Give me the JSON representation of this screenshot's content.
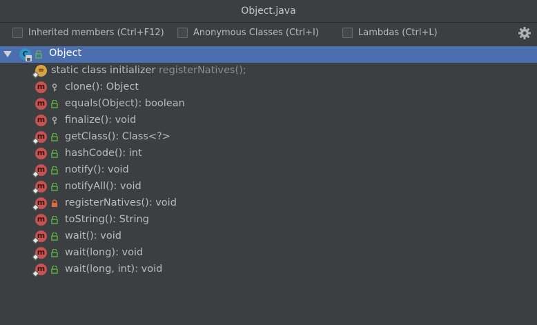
{
  "window": {
    "title": "Object.java"
  },
  "toolbar": {
    "inherited_label": "Inherited members (Ctrl+F12)",
    "anonymous_label": "Anonymous Classes (Ctrl+I)",
    "lambdas_label": "Lambdas (Ctrl+L)",
    "settings_icon": "gear-icon"
  },
  "tree": {
    "root": {
      "label": "Object",
      "icon": "class-icon",
      "icon_letter": "C"
    },
    "init": {
      "label": "static class initializer",
      "detail": "registerNatives();",
      "icon_letter": "="
    },
    "method_icon_letter": "m",
    "methods": [
      {
        "label": "clone(): Object",
        "visibility": "protected"
      },
      {
        "label": "equals(Object): boolean",
        "visibility": "public"
      },
      {
        "label": "finalize(): void",
        "visibility": "protected"
      },
      {
        "label": "getClass(): Class<?>",
        "visibility": "public"
      },
      {
        "label": "hashCode(): int",
        "visibility": "public"
      },
      {
        "label": "notify(): void",
        "visibility": "public"
      },
      {
        "label": "notifyAll(): void",
        "visibility": "public"
      },
      {
        "label": "registerNatives(): void",
        "visibility": "private"
      },
      {
        "label": "toString(): String",
        "visibility": "public"
      },
      {
        "label": "wait(): void",
        "visibility": "public"
      },
      {
        "label": "wait(long): void",
        "visibility": "public"
      },
      {
        "label": "wait(long, int): void",
        "visibility": "public"
      }
    ]
  },
  "colors": {
    "background": "#3c3f41",
    "selection": "#4b6eaf",
    "method_icon": "#c75450",
    "class_icon": "#3592c4",
    "init_icon": "#d9a343",
    "public_lock": "#62b543",
    "private_lock": "#e06c3c"
  }
}
